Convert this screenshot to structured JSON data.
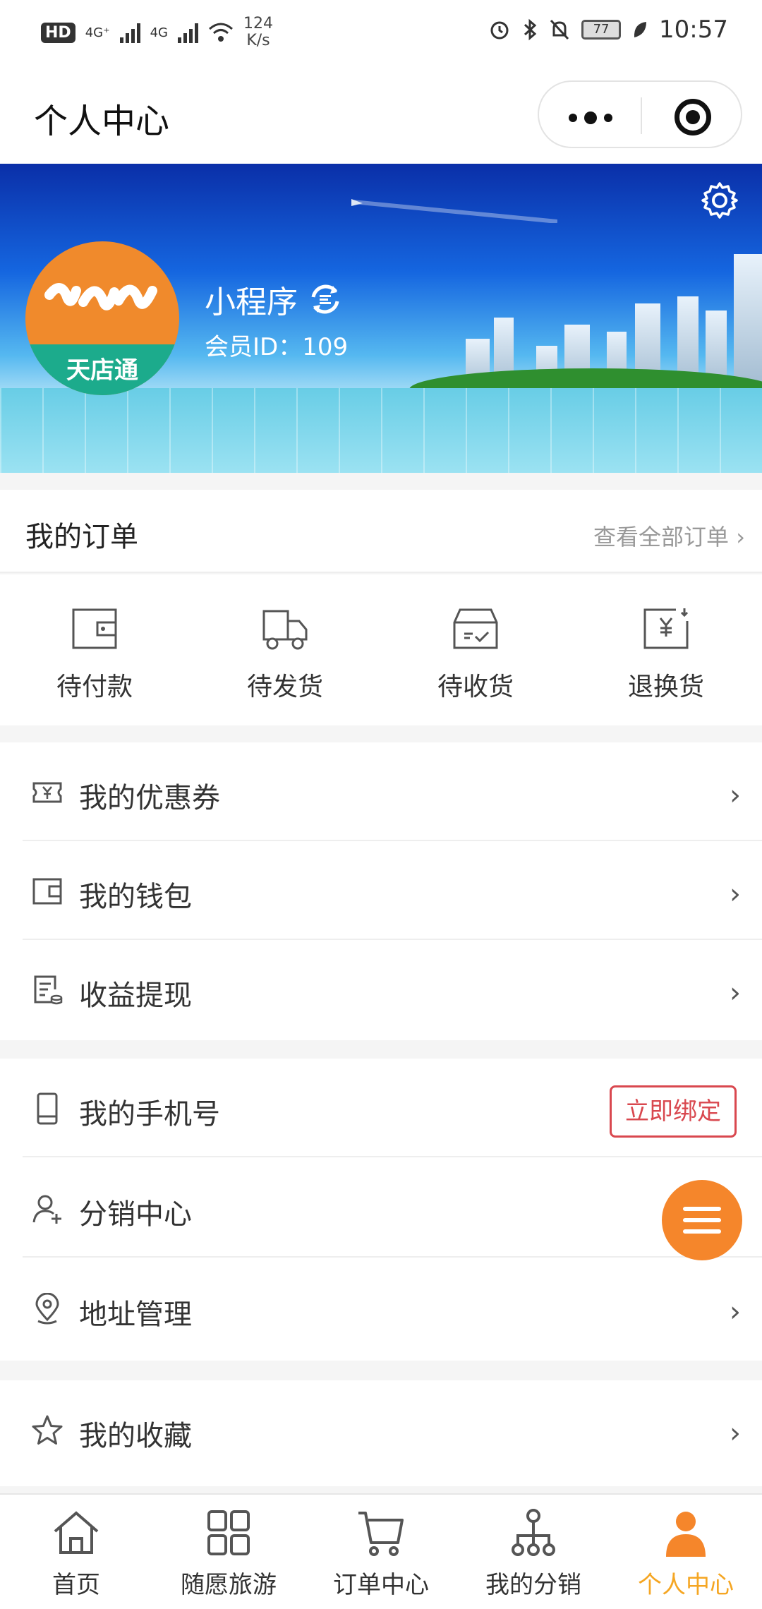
{
  "status_bar": {
    "hd": "HD",
    "net1": "4G⁺",
    "net2": "4G",
    "speed_value": "124",
    "speed_unit": "K/s",
    "battery": "77",
    "time": "10:57"
  },
  "header": {
    "title": "个人中心"
  },
  "profile": {
    "avatar_brand": "天店通",
    "name": "小程序",
    "member_id": "会员ID：109"
  },
  "orders": {
    "title": "我的订单",
    "view_all": "查看全部订单 ›",
    "items": [
      {
        "label": "待付款",
        "icon": "wallet-icon"
      },
      {
        "label": "待发货",
        "icon": "truck-icon"
      },
      {
        "label": "待收货",
        "icon": "box-check-icon"
      },
      {
        "label": "退换货",
        "icon": "refund-icon"
      }
    ]
  },
  "menu_group1": [
    {
      "label": "我的优惠券",
      "icon": "coupon-icon"
    },
    {
      "label": "我的钱包",
      "icon": "wallet-icon"
    },
    {
      "label": "收益提现",
      "icon": "earnings-icon"
    }
  ],
  "menu_group2": [
    {
      "label": "我的手机号",
      "icon": "phone-icon",
      "action": "立即绑定"
    },
    {
      "label": "分销中心",
      "icon": "add-user-icon"
    },
    {
      "label": "地址管理",
      "icon": "location-icon"
    }
  ],
  "menu_group3": [
    {
      "label": "我的收藏",
      "icon": "star-icon"
    }
  ],
  "tabbar": {
    "items": [
      {
        "label": "首页",
        "icon": "home-icon"
      },
      {
        "label": "随愿旅游",
        "icon": "grid-icon"
      },
      {
        "label": "订单中心",
        "icon": "cart-icon"
      },
      {
        "label": "我的分销",
        "icon": "network-icon"
      },
      {
        "label": "个人中心",
        "icon": "person-icon",
        "active": true
      }
    ]
  },
  "colors": {
    "accent": "#f5a623",
    "fab": "#f5862b",
    "bind_button": "#d9484f"
  }
}
